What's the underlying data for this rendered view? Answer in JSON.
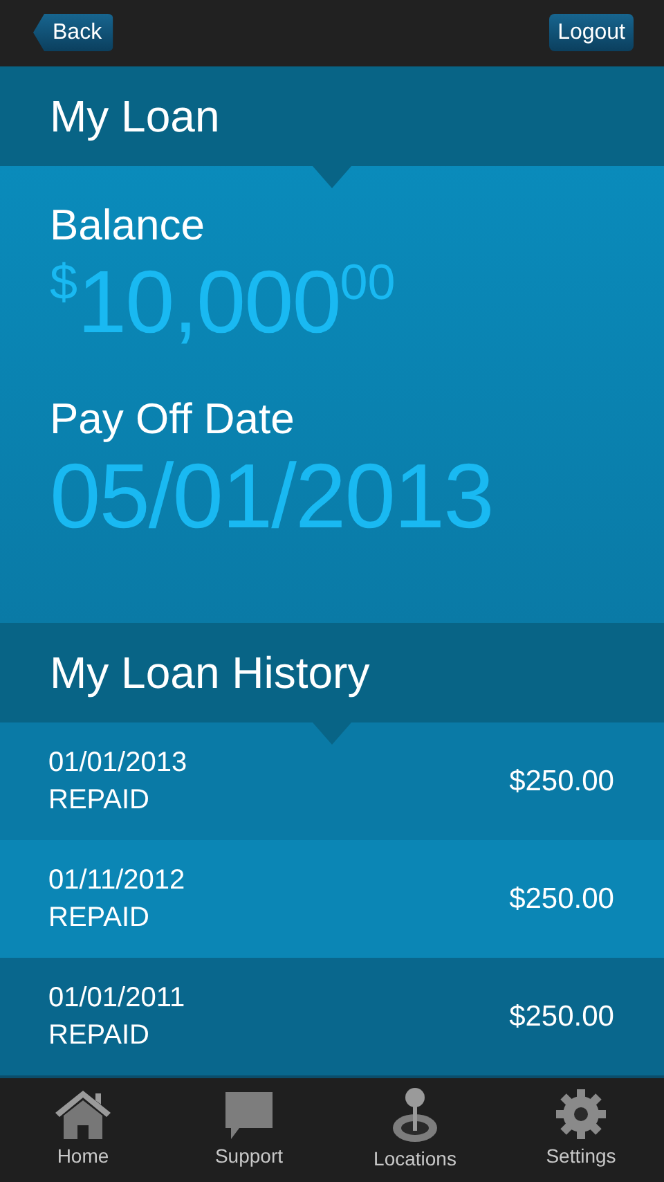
{
  "nav_bar": {
    "back": "Back",
    "logout": "Logout"
  },
  "loan": {
    "title": "My Loan",
    "balance_label": "Balance",
    "currency": "$",
    "balance_whole": "10,000",
    "balance_cents": "00",
    "payoff_label": "Pay Off Date",
    "payoff_date": "05/01/2013"
  },
  "history": {
    "title": "My Loan History",
    "rows": [
      {
        "date": "01/01/2013",
        "status": "REPAID",
        "amount": "$250.00"
      },
      {
        "date": "01/11/2012",
        "status": "REPAID",
        "amount": "$250.00"
      },
      {
        "date": "01/01/2011",
        "status": "REPAID",
        "amount": "$250.00"
      }
    ]
  },
  "tab_bar": [
    {
      "kind": "home",
      "label": "Home"
    },
    {
      "kind": "support",
      "label": "Support"
    },
    {
      "kind": "locations",
      "label": "Locations"
    },
    {
      "kind": "settings",
      "label": "Settings"
    }
  ]
}
